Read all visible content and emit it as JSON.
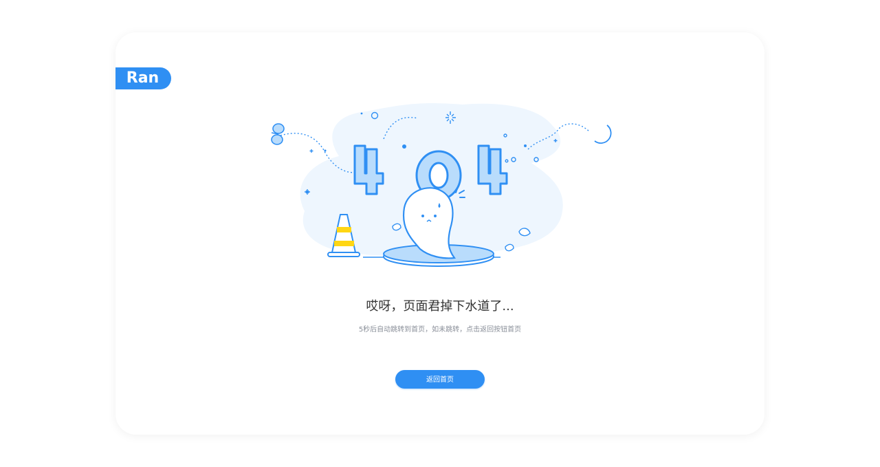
{
  "logo": {
    "text": "Ran"
  },
  "illustration": {
    "code": "404"
  },
  "message": {
    "title": "哎呀，页面君掉下水道了...",
    "subtitle": "5秒后自动跳转到首页，如未跳转，点击返回按钮首页"
  },
  "actions": {
    "back_home_label": "返回首页"
  },
  "colors": {
    "primary": "#2f8ff3",
    "light_blue": "#b9dcfc",
    "pale_blue": "#eef6fe",
    "cone_yellow": "#ffd614"
  }
}
